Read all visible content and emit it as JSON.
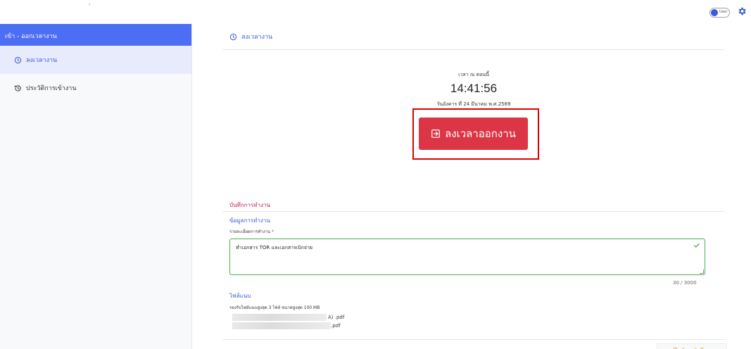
{
  "topbar": {
    "toggle_label": "User"
  },
  "sidebar": {
    "header": "เข้า - ออกเวลางาน",
    "items": [
      {
        "label": "ลงเวลางาน",
        "icon": "clock-icon",
        "active": true
      },
      {
        "label": "ประวัติการเข้างาน",
        "icon": "history-icon",
        "active": false
      }
    ]
  },
  "main": {
    "title": "ลงเวลางาน",
    "now_label": "เวลา ณ ตอนนี้",
    "time": "14:41:56",
    "date": "วันอังคาร ที่ 24 มีนาคม พ.ศ.2569",
    "clock_out_button": "ลงเวลาออกงาน",
    "worklog_title": "บันทึกการทำงาน",
    "worklog_subtitle": "ข้อมูลการทำงาน",
    "detail_label": "รายละเอียดการทำงาน",
    "required_mark": "*",
    "detail_value": "ทำเอกสาร TOR และเอกสารเบิกจ่าย",
    "char_counter": "30 / 3000",
    "attachments_title": "ไฟล์แนบ",
    "attachments_note": "รองรับไฟล์แนบสูงสุด 3 ไฟล์ ขนาดสูงสุด 100 MB",
    "files": [
      {
        "suffix": "A) .pdf"
      },
      {
        "suffix": ".pdf"
      }
    ],
    "edit_button": "แก้ไขข้อมูลบันทึกงาน"
  },
  "colors": {
    "primary": "#4c6ef5",
    "danger": "#dc3545",
    "highlight_frame": "#e00000",
    "success": "#4caf50",
    "warning": "#f08c00"
  }
}
